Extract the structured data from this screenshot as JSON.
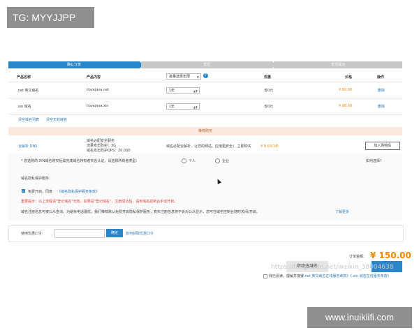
{
  "watermarks": {
    "top_left": "TG: MYYJJPP",
    "bottom_right": "www.inuikiifi.com"
  },
  "steps": [
    "确认订单",
    "支付",
    "支付成功"
  ],
  "table": {
    "headers": [
      "产品名称",
      "产品内容",
      "优惠",
      "价格",
      "操作"
    ],
    "duration_header": "批量选择年限",
    "rows": [
      {
        "name": ".net 英文域名",
        "content": "ilovejava.net",
        "years": "1年",
        "discount": "省0元",
        "price": "¥ 60.00",
        "action": "删除"
      },
      {
        "name": ".xin 域名",
        "content": "ilovejava.xin",
        "years": "1年",
        "discount": "省0元",
        "price": "¥ 88.00",
        "action": "删除"
      }
    ],
    "bottom_links": [
      "清空域名列表",
      "清空无效域名"
    ]
  },
  "recommend": {
    "bar_title": "推荐购买",
    "item_name": "云解析 DNS",
    "item_lines": [
      "域名必配安全服务",
      "流量攻击防护：3G",
      "域名攻击防护QPS：20,000"
    ],
    "item_desc": "域名必配云解析，让您的网站、应用更安全！ 立即购买",
    "item_price": "¥ 0.00/1年",
    "item_button": "加入购物车"
  },
  "realname": {
    "prompt": "* 您选购的.XIN域名购买后需完成域名持有者实名认证，请选择所有者类型：",
    "options": [
      "个人",
      "企业"
    ],
    "help": "如何选择?"
  },
  "privacy": {
    "title": "域名隐私保护服务：",
    "agree_text": "免费开启，同意",
    "agree_link": "《域名隐私保护服务条款》",
    "warning": "重要提示：以上流程请\"登记域名\"无效，如果是\"登记域名\"，注册成功后，请到域名控制台手动开启。",
    "note": "域名注册信息可被公众查询，为避免电话骚扰，我们推荐默认免费开启隐私保护服务，真实注册信息将不会对公众显示，您可在域名控制台随时关闭/开启。",
    "more": "了解更多"
  },
  "coupon": {
    "label": "使用优惠口令：",
    "placeholder": "",
    "button": "确定",
    "help": "如何获取优惠口令"
  },
  "total": {
    "label": "订单金额：",
    "amount": "¥ 150.00",
    "continue_button": "继续选域名",
    "ghost_text": "https://blog.csdn.net/weixin_38004638",
    "agree_prefix": "我已阅读，理解并接受",
    "agree_links": "《.net 英文域名在线服务条款》《.xin 域名在线服务条款》"
  },
  "colors": {
    "accent": "#2a86c8",
    "price": "#f08a00",
    "warning": "#e0453c",
    "recommend_bar": "#fbe9df"
  }
}
